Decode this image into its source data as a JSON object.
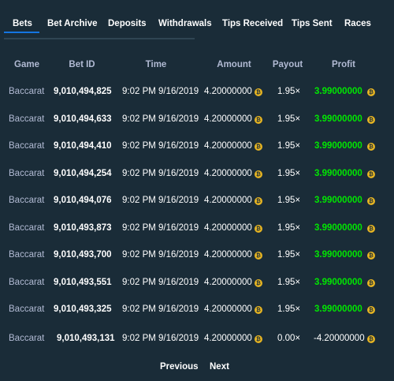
{
  "tabs": [
    {
      "label": "Bets",
      "active": true
    },
    {
      "label": "Bet Archive",
      "active": false
    },
    {
      "label": "Deposits",
      "active": false
    },
    {
      "label": "Withdrawals",
      "active": false
    },
    {
      "label": "Tips Received",
      "active": false
    },
    {
      "label": "Tips Sent",
      "active": false
    },
    {
      "label": "Races",
      "active": false
    }
  ],
  "table": {
    "columns": [
      "Game",
      "Bet ID",
      "Time",
      "Amount",
      "Payout",
      "Profit"
    ],
    "rows": [
      {
        "game": "Baccarat",
        "bet_id": "9,010,494,825",
        "time": "9:02 PM 9/16/2019",
        "amount": "4.20000000",
        "payout": "1.95×",
        "profit": "3.99000000",
        "profit_positive": true
      },
      {
        "game": "Baccarat",
        "bet_id": "9,010,494,633",
        "time": "9:02 PM 9/16/2019",
        "amount": "4.20000000",
        "payout": "1.95×",
        "profit": "3.99000000",
        "profit_positive": true
      },
      {
        "game": "Baccarat",
        "bet_id": "9,010,494,410",
        "time": "9:02 PM 9/16/2019",
        "amount": "4.20000000",
        "payout": "1.95×",
        "profit": "3.99000000",
        "profit_positive": true
      },
      {
        "game": "Baccarat",
        "bet_id": "9,010,494,254",
        "time": "9:02 PM 9/16/2019",
        "amount": "4.20000000",
        "payout": "1.95×",
        "profit": "3.99000000",
        "profit_positive": true
      },
      {
        "game": "Baccarat",
        "bet_id": "9,010,494,076",
        "time": "9:02 PM 9/16/2019",
        "amount": "4.20000000",
        "payout": "1.95×",
        "profit": "3.99000000",
        "profit_positive": true
      },
      {
        "game": "Baccarat",
        "bet_id": "9,010,493,873",
        "time": "9:02 PM 9/16/2019",
        "amount": "4.20000000",
        "payout": "1.95×",
        "profit": "3.99000000",
        "profit_positive": true
      },
      {
        "game": "Baccarat",
        "bet_id": "9,010,493,700",
        "time": "9:02 PM 9/16/2019",
        "amount": "4.20000000",
        "payout": "1.95×",
        "profit": "3.99000000",
        "profit_positive": true
      },
      {
        "game": "Baccarat",
        "bet_id": "9,010,493,551",
        "time": "9:02 PM 9/16/2019",
        "amount": "4.20000000",
        "payout": "1.95×",
        "profit": "3.99000000",
        "profit_positive": true
      },
      {
        "game": "Baccarat",
        "bet_id": "9,010,493,325",
        "time": "9:02 PM 9/16/2019",
        "amount": "4.20000000",
        "payout": "1.95×",
        "profit": "3.99000000",
        "profit_positive": true
      },
      {
        "game": "Baccarat",
        "bet_id": "9,010,493,131",
        "time": "9:02 PM 9/16/2019",
        "amount": "4.20000000",
        "payout": "0.00×",
        "profit": "-4.20000000",
        "profit_positive": false
      }
    ]
  },
  "pagination": {
    "previous": "Previous",
    "next": "Next"
  },
  "icons": {
    "currency": "bitcoin-coin-icon"
  },
  "colors": {
    "background": "#1a2c38",
    "accent": "#1475e1",
    "profit_positive": "#00e701",
    "coin": "#e6b422",
    "muted_text": "#b1bad3"
  }
}
